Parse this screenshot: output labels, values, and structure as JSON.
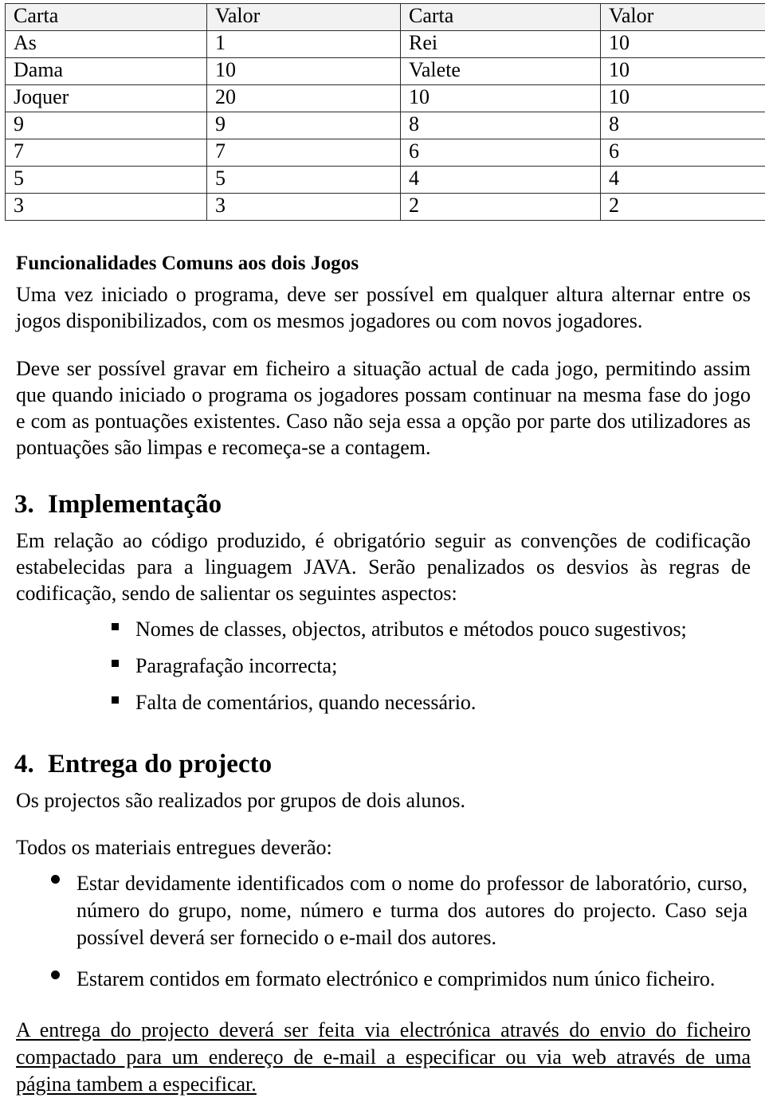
{
  "table": {
    "headers": [
      "Carta",
      "Valor",
      "Carta",
      "Valor"
    ],
    "rows": [
      [
        "As",
        "1",
        "Rei",
        "10"
      ],
      [
        "Dama",
        "10",
        "Valete",
        "10"
      ],
      [
        "Joquer",
        "20",
        "10",
        "10"
      ],
      [
        "9",
        "9",
        "8",
        "8"
      ],
      [
        "7",
        "7",
        "6",
        "6"
      ],
      [
        "5",
        "5",
        "4",
        "4"
      ],
      [
        "3",
        "3",
        "2",
        "2"
      ]
    ]
  },
  "common_features": {
    "heading": "Funcionalidades Comuns aos dois Jogos",
    "paragraph_1": "Uma vez iniciado o programa, deve ser possível em qualquer altura alternar entre os jogos disponibilizados, com os mesmos jogadores ou com novos jogadores.",
    "paragraph_2": "Deve ser possível gravar em ficheiro a situação actual de cada jogo, permitindo assim que quando iniciado o programa os jogadores possam continuar na mesma fase do jogo e com as pontuações existentes. Caso não seja essa a opção por parte dos utilizadores as pontuações são limpas e recomeça-se a contagem."
  },
  "section_3": {
    "number": "3.",
    "title": "Implementação",
    "paragraph": "Em relação ao código produzido, é obrigatório seguir as convenções de codificação estabelecidas para a linguagem JAVA. Serão penalizados os desvios às regras de codificação, sendo de salientar os seguintes aspectos:",
    "bullets": [
      "Nomes de classes, objectos, atributos e métodos pouco sugestivos;",
      "Paragrafação incorrecta;",
      "Falta de comentários, quando necessário."
    ]
  },
  "section_4": {
    "number": "4.",
    "title": "Entrega do projecto",
    "paragraph_1": "Os projectos são realizados por grupos de dois alunos.",
    "paragraph_2": "Todos os materiais entregues deverão:",
    "bullets": [
      "Estar devidamente identificados com o nome do professor de laboratório, curso, número do grupo, nome, número e turma dos autores do projecto. Caso seja possível deverá ser fornecido o e-mail dos autores.",
      "Estarem contidos em formato electrónico e comprimidos num único ficheiro."
    ],
    "footer_line_1": "A entrega do projecto deverá ser feita via electrónica através do envio do ficheiro",
    "footer_line_2": "compactado para um endereço de e-mail a especificar ou via web através de uma",
    "footer_line_3": "página tambem a especificar."
  }
}
